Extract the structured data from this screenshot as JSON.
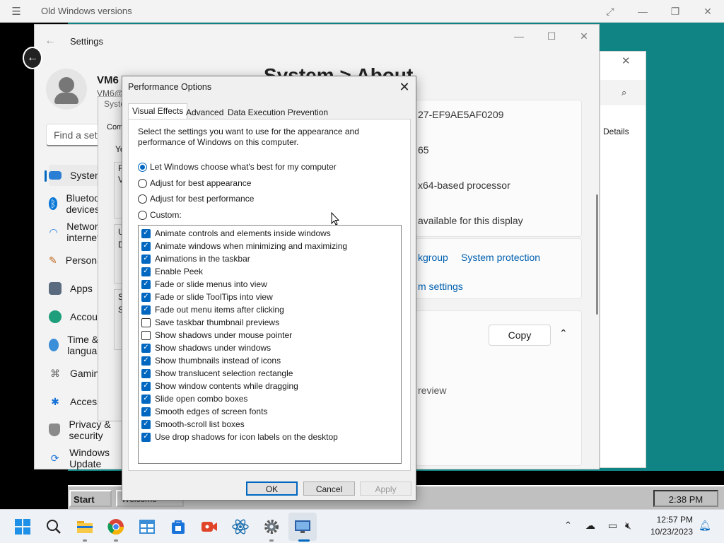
{
  "host": {
    "title": "Old Windows versions"
  },
  "win98": {
    "start_label": "Start",
    "task_label": "Welcome",
    "clock": "2:38 PM"
  },
  "settings": {
    "title": "Settings",
    "user_name": "VM6",
    "user_email": "VM6@",
    "search_placeholder": "Find a setting",
    "page_title": "System  >  About",
    "nav": [
      "System",
      "Bluetooth & devices",
      "Network & internet",
      "Personalization",
      "Apps",
      "Accounts",
      "Time & language",
      "Gaming",
      "Accessibility",
      "Privacy & security",
      "Windows Update"
    ],
    "device_id": "27-EF9AE5AF0209",
    "product_id": "65",
    "system_type": "x64-based processor",
    "pen_touch": "available for this display",
    "link_domain": "kgroup",
    "link_protection": "System protection",
    "link_advanced": "m settings",
    "copy_label": "Copy",
    "edition_tail": "review"
  },
  "sysprops": {
    "title": "Syste",
    "tab": "Com",
    "lines": [
      "Yo",
      "F",
      "V",
      "U",
      "D",
      "S",
      "S"
    ]
  },
  "right_window": {
    "details": "Details"
  },
  "perf": {
    "title": "Performance Options",
    "tabs": [
      "Visual Effects",
      "Advanced",
      "Data Execution Prevention"
    ],
    "intro": "Select the settings you want to use for the appearance and performance of Windows on this computer.",
    "radios": [
      {
        "label": "Let Windows choose what's best for my computer",
        "selected": true
      },
      {
        "label": "Adjust for best appearance",
        "selected": false
      },
      {
        "label": "Adjust for best performance",
        "selected": false
      },
      {
        "label": "Custom:",
        "selected": false
      }
    ],
    "effects": [
      {
        "label": "Animate controls and elements inside windows",
        "checked": true
      },
      {
        "label": "Animate windows when minimizing and maximizing",
        "checked": true
      },
      {
        "label": "Animations in the taskbar",
        "checked": true
      },
      {
        "label": "Enable Peek",
        "checked": true
      },
      {
        "label": "Fade or slide menus into view",
        "checked": true
      },
      {
        "label": "Fade or slide ToolTips into view",
        "checked": true
      },
      {
        "label": "Fade out menu items after clicking",
        "checked": true
      },
      {
        "label": "Save taskbar thumbnail previews",
        "checked": false
      },
      {
        "label": "Show shadows under mouse pointer",
        "checked": false
      },
      {
        "label": "Show shadows under windows",
        "checked": true
      },
      {
        "label": "Show thumbnails instead of icons",
        "checked": true
      },
      {
        "label": "Show translucent selection rectangle",
        "checked": true
      },
      {
        "label": "Show window contents while dragging",
        "checked": true
      },
      {
        "label": "Slide open combo boxes",
        "checked": true
      },
      {
        "label": "Smooth edges of screen fonts",
        "checked": true
      },
      {
        "label": "Smooth-scroll list boxes",
        "checked": true
      },
      {
        "label": "Use drop shadows for icon labels on the desktop",
        "checked": true
      }
    ],
    "ok": "OK",
    "cancel": "Cancel",
    "apply": "Apply"
  },
  "taskbar": {
    "time": "12:57 PM",
    "date": "10/23/2023",
    "icons": [
      "windows-start",
      "search",
      "file-explorer",
      "chrome",
      "windows-app",
      "store",
      "camera",
      "react-app",
      "settings",
      "remote-desktop"
    ],
    "accent": "#0067c0"
  }
}
